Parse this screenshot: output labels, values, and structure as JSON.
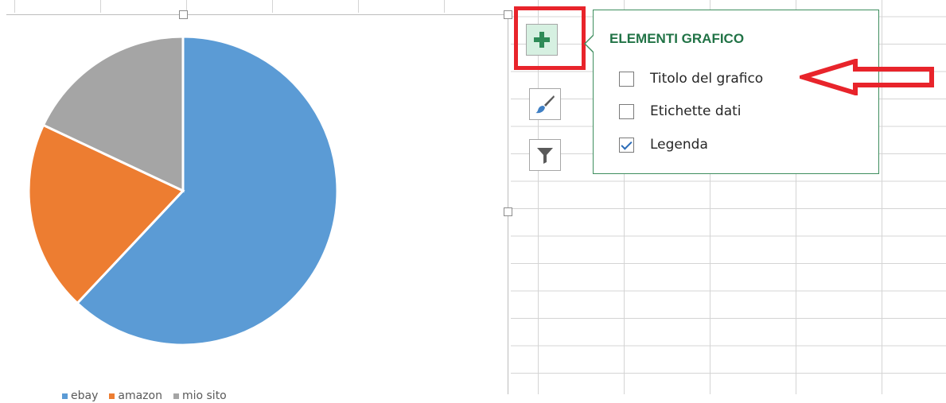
{
  "chart": {
    "legend_items": [
      {
        "label": "ebay",
        "color": "#5b9bd5"
      },
      {
        "label": "amazon",
        "color": "#ed7d31"
      },
      {
        "label": "mio sito",
        "color": "#a5a5a5"
      }
    ]
  },
  "chart_data": {
    "type": "pie",
    "categories": [
      "ebay",
      "amazon",
      "mio sito"
    ],
    "values": [
      62,
      20,
      18
    ],
    "colors": [
      "#5b9bd5",
      "#ed7d31",
      "#a5a5a5"
    ],
    "title": "",
    "legend": "bottom"
  },
  "side_buttons": [
    {
      "name": "chart-elements-button",
      "icon": "plus-icon",
      "active": true
    },
    {
      "name": "chart-styles-button",
      "icon": "paintbrush-icon",
      "active": false
    },
    {
      "name": "chart-filters-button",
      "icon": "funnel-icon",
      "active": false
    }
  ],
  "popup": {
    "title": "ELEMENTI GRAFICO",
    "options": [
      {
        "label": "Titolo del grafico",
        "checked": false
      },
      {
        "label": "Etichette dati",
        "checked": false
      },
      {
        "label": "Legenda",
        "checked": true
      }
    ]
  },
  "annotation": {
    "highlight_color": "#e8242b"
  }
}
